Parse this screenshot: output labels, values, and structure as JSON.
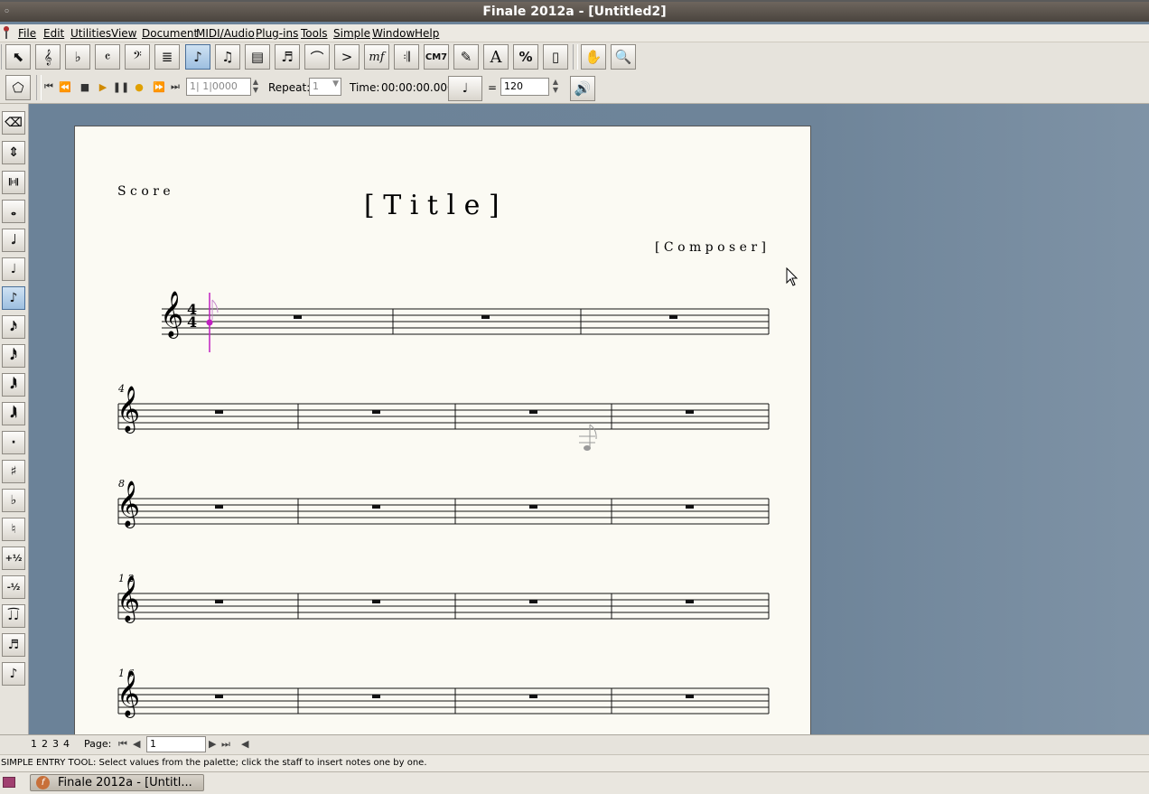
{
  "window": {
    "title": "Finale 2012a - [Untitled2]"
  },
  "menu": [
    "File",
    "Edit",
    "Utilities",
    "View",
    "Document",
    "MIDI/Audio",
    "Plug-ins",
    "Tools",
    "Simple",
    "Window",
    "Help"
  ],
  "transport": {
    "counter": "1| 1|0000",
    "repeat_label": "Repeat:",
    "repeat_value": "1",
    "time_label": "Time:",
    "time_value": "00:00:00.000",
    "equals": "=",
    "tempo": "120"
  },
  "score": {
    "part_label": "S c o r e",
    "title": "[ T i t l e ]",
    "composer": "[ C o m p o s e r ]",
    "time_signature_top": "4",
    "time_signature_bottom": "4",
    "measure_numbers": [
      "4",
      "8",
      "1 2",
      "1 6"
    ]
  },
  "pagebar": {
    "tabs": [
      "1",
      "2",
      "3",
      "4"
    ],
    "page_label": "Page:",
    "page_value": "1"
  },
  "status": {
    "text": "SIMPLE ENTRY TOOL: Select values from the palette; click the staff to insert notes one by one."
  },
  "taskbar": {
    "window_button": "Finale 2012a - [Untitl..."
  },
  "icons": {
    "toolbar1": [
      "selection-tool-icon",
      "staff-tool-icon",
      "key-signature-tool-icon",
      "time-signature-tool-icon",
      "clef-tool-icon",
      "measure-tool-icon",
      "simple-entry-tool-icon",
      "speedy-entry-tool-icon",
      "hyperscribe-tool-icon",
      "tuplet-tool-icon",
      "smart-shape-tool-icon",
      "articulation-tool-icon",
      "expression-tool-icon",
      "repeat-tool-icon",
      "chord-tool-icon",
      "lyrics-tool-icon",
      "text-tool-icon",
      "resize-tool-icon",
      "page-layout-tool-icon",
      "hand-grabber-icon",
      "zoom-icon"
    ],
    "left_palette": [
      "eraser-icon",
      "select-icon",
      "ossia-icon",
      "whole-note-icon",
      "half-note-icon",
      "quarter-note-icon",
      "eighth-note-icon",
      "sixteenth-note-icon",
      "thirty-second-note-icon",
      "sixty-fourth-note-icon",
      "one-twenty-eighth-note-icon",
      "dot-icon",
      "sharp-icon",
      "flat-icon",
      "natural-icon",
      "half-step-up-icon",
      "half-step-down-icon",
      "tie-icon",
      "tuplet-icon",
      "grace-note-icon"
    ]
  }
}
